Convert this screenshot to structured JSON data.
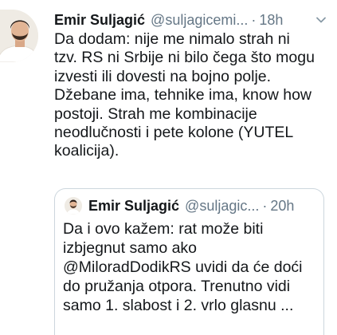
{
  "tweet": {
    "author_name": "Emir Suljagić",
    "handle": "@suljagicemi...",
    "separator": "·",
    "time": "18h",
    "text": "Da dodam: nije me nimalo strah ni\ntzv. RS ni Srbije ni bilo čega što mogu\nizvesti ili dovesti na bojno polje.\nDžebane ima, tehnike ima, know how\npostoji. Strah me kombinacije\nneodlučnosti i pete kolone (YUTEL\nkoalicija)."
  },
  "quoted_tweet": {
    "author_name": "Emir Suljagić",
    "handle": "@suljagic...",
    "separator": "·",
    "time": "20h",
    "text": "Da i ovo kažem: rat može biti\nizbjegnut samo ako\n@MiloradDodikRS uvidi da će doći\ndo pružanja otpora. Trenutno vidi\nsamo 1. slabost i 2. vrlo glasnu ..."
  },
  "icons": {
    "more": "chevron-down-icon",
    "avatar": "user-avatar",
    "quoted_avatar": "user-avatar"
  },
  "colors": {
    "text": "#14171a",
    "secondary": "#657786",
    "border": "#ccd6dd"
  }
}
